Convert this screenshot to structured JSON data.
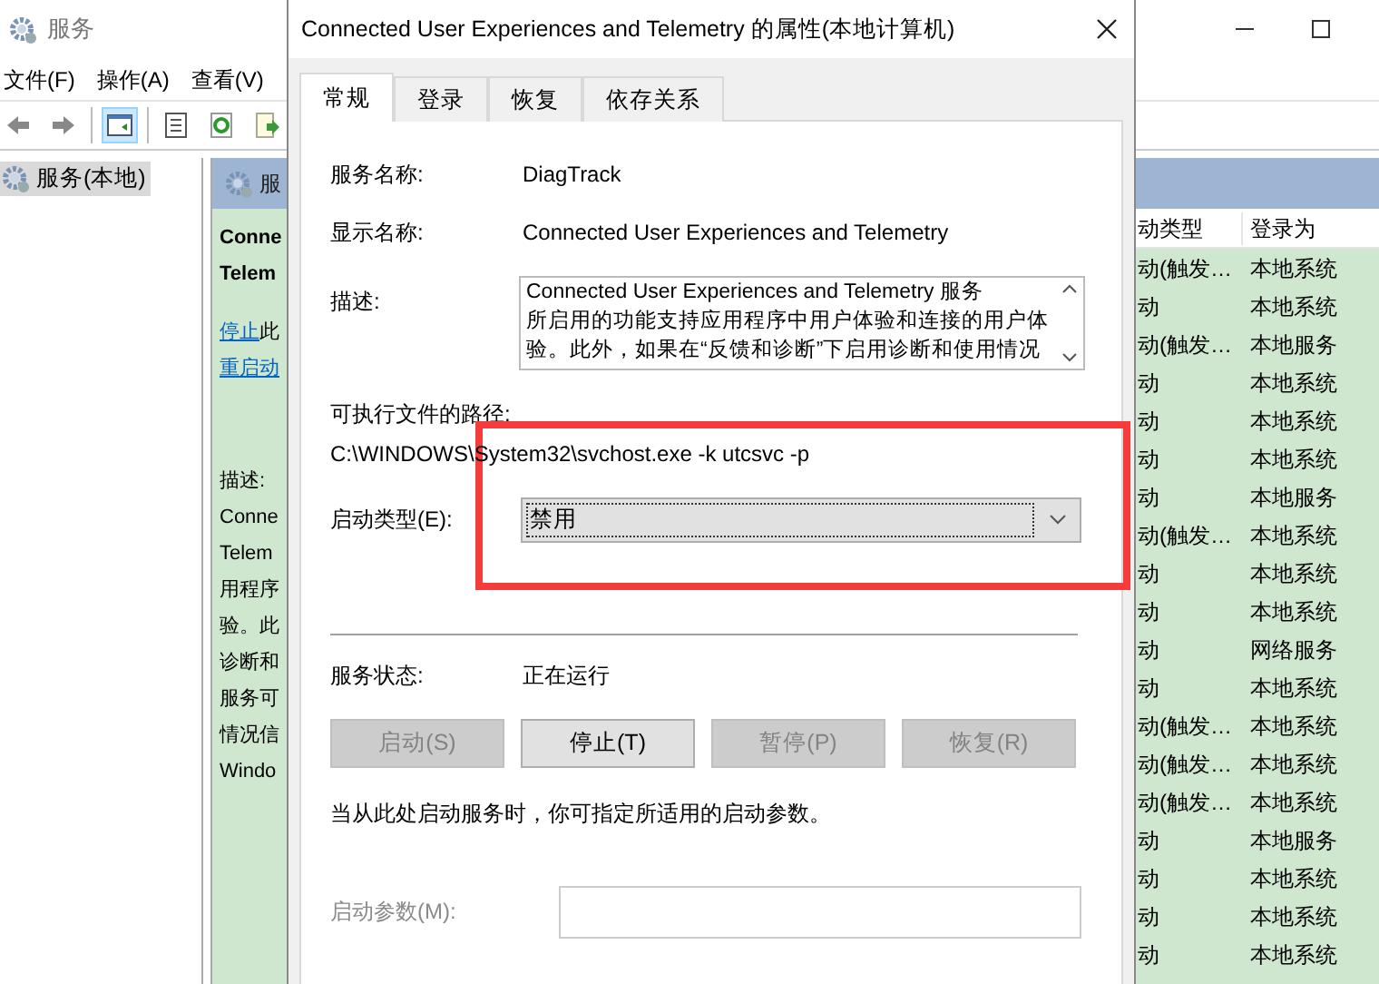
{
  "window": {
    "title": "服务",
    "menu": [
      "文件(F)",
      "操作(A)",
      "查看(V)"
    ],
    "toolbar": [
      {
        "kind": "back",
        "selected": false
      },
      {
        "kind": "forward",
        "selected": false
      },
      {
        "kind": "sep"
      },
      {
        "kind": "tree",
        "selected": true
      },
      {
        "kind": "sep"
      },
      {
        "kind": "properties",
        "selected": false
      },
      {
        "kind": "refresh",
        "selected": false
      },
      {
        "kind": "export",
        "selected": false
      }
    ],
    "tree": [
      {
        "label": "服务(本地)",
        "selected": true
      }
    ],
    "detail_header": "服",
    "detail": {
      "title_lines": [
        "Conne",
        "Telem"
      ],
      "actions": [
        {
          "link": "停止",
          "rest": "此"
        },
        {
          "link": "重启动"
        }
      ],
      "description_label": "描述:",
      "description_lines": [
        "Conne",
        "Telem",
        "用程序",
        "验。此",
        "诊断和",
        "服务可",
        "情况信",
        "Windo"
      ]
    },
    "list": {
      "columns": [
        "动类型",
        "登录为"
      ],
      "rows": [
        [
          "动(触发…",
          "本地系统"
        ],
        [
          "动",
          "本地系统"
        ],
        [
          "动(触发…",
          "本地服务"
        ],
        [
          "动",
          "本地系统"
        ],
        [
          "动",
          "本地系统"
        ],
        [
          "动",
          "本地系统"
        ],
        [
          "动",
          "本地服务"
        ],
        [
          "动(触发…",
          "本地系统"
        ],
        [
          "动",
          "本地系统"
        ],
        [
          "动",
          "本地系统"
        ],
        [
          "动",
          "网络服务"
        ],
        [
          "动",
          "本地系统"
        ],
        [
          "动(触发…",
          "本地系统"
        ],
        [
          "动(触发…",
          "本地系统"
        ],
        [
          "动(触发…",
          "本地系统"
        ],
        [
          "动",
          "本地服务"
        ],
        [
          "动",
          "本地系统"
        ],
        [
          "动",
          "本地系统"
        ],
        [
          "动",
          "本地系统"
        ]
      ]
    }
  },
  "dialog": {
    "title": "Connected User Experiences and Telemetry 的属性(本地计算机)",
    "tabs": [
      {
        "label": "常规",
        "selected": true
      },
      {
        "label": "登录",
        "selected": false
      },
      {
        "label": "恢复",
        "selected": false
      },
      {
        "label": "依存关系",
        "selected": false
      }
    ],
    "service_name": {
      "label": "服务名称:",
      "value": "DiagTrack"
    },
    "display_name": {
      "label": "显示名称:",
      "value": "Connected User Experiences and Telemetry"
    },
    "description": {
      "label": "描述:",
      "lines": [
        "Connected User Experiences and Telemetry 服务",
        "所启用的功能支持应用程序中用户体验和连接的用户体",
        "验。此外，如果在“反馈和诊断”下启用诊断和使用情况"
      ]
    },
    "path": {
      "label": "可执行文件的路径:",
      "value": "C:\\WINDOWS\\System32\\svchost.exe -k utcsvc -p"
    },
    "startup_type": {
      "label": "启动类型(E):",
      "value": "禁用"
    },
    "status": {
      "label": "服务状态:",
      "value": "正在运行"
    },
    "buttons": [
      {
        "label": "启动(S)",
        "disabled": true
      },
      {
        "label": "停止(T)",
        "disabled": false
      },
      {
        "label": "暂停(P)",
        "disabled": true
      },
      {
        "label": "恢复(R)",
        "disabled": true
      }
    ],
    "hint": "当从此处启动服务时，你可指定所适用的启动参数。",
    "params": {
      "label": "启动参数(M):",
      "disabled": true
    }
  }
}
